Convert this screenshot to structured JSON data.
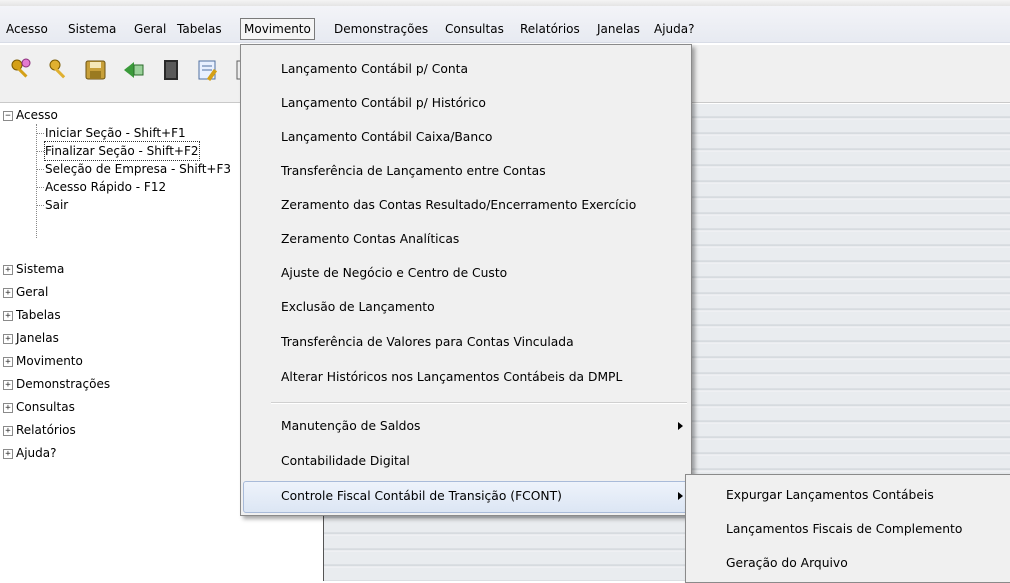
{
  "menubar": {
    "items": [
      "Acesso",
      "Sistema",
      "Geral",
      "Tabelas",
      "Movimento",
      "Demonstrações",
      "Consultas",
      "Relatórios",
      "Janelas",
      "Ajuda?"
    ],
    "active": "Movimento"
  },
  "toolbar": {
    "icons": [
      "keys-icon",
      "key-icon",
      "save-icon",
      "prev-icon",
      "book-icon",
      "edit-icon",
      "calendar-icon"
    ]
  },
  "tree": {
    "acesso": {
      "label": "Acesso",
      "children": [
        "Iniciar Seção - Shift+F1",
        "Finalizar Seção - Shift+F2",
        "Seleção de Empresa - Shift+F3",
        "Acesso Rápido - F12",
        "Sair"
      ]
    },
    "collapsed": [
      "Sistema",
      "Geral",
      "Tabelas",
      "Janelas",
      "Movimento",
      "Demonstrações",
      "Consultas",
      "Relatórios",
      "Ajuda?"
    ]
  },
  "movimento_menu": {
    "items": [
      "Lançamento Contábil p/ Conta",
      "Lançamento Contábil p/ Histórico",
      "Lançamento Contábil Caixa/Banco",
      "Transferência de Lançamento entre Contas",
      "Zeramento das Contas Resultado/Encerramento Exercício",
      "Zeramento Contas Analíticas",
      "Ajuste de Negócio e Centro de Custo",
      "Exclusão de Lançamento",
      "Transferência de Valores para Contas Vinculada",
      "Alterar Históricos nos Lançamentos Contábeis da DMPL"
    ],
    "items2": [
      "Manutenção de Saldos",
      "Contabilidade Digital",
      "Controle Fiscal Contábil de Transição (FCONT)"
    ]
  },
  "fcont_submenu": {
    "items": [
      "Expurgar Lançamentos Contábeis",
      "Lançamentos Fiscais de Complemento",
      "Geração do Arquivo"
    ]
  },
  "colors": {
    "highlight": "#dce6f4",
    "menu_bg": "#f0f0f0"
  }
}
